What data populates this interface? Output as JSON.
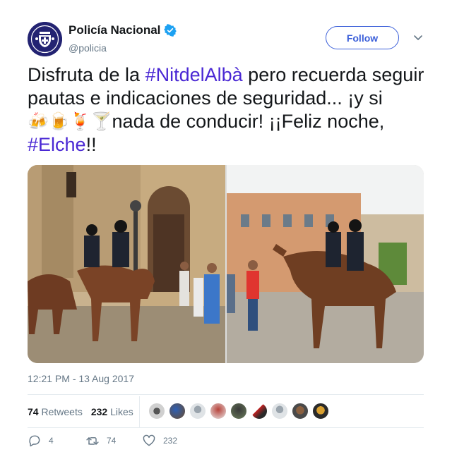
{
  "account": {
    "name": "Policía Nacional",
    "handle": "@policia",
    "verified": true,
    "avatar_icon": "policia-nacional-shield-emblem"
  },
  "header": {
    "follow_label": "Follow",
    "more_icon": "chevron-down-icon"
  },
  "tweet": {
    "segments": {
      "s1": "Disfruta de la ",
      "h1": "#NitdelAlbà",
      "s2": " pero recuerda seguir pautas e indicaciones de seguridad... ¡y si ",
      "emojis": "🍻🍺🍹🍸",
      "s3": "nada de conducir! ¡¡Feliz noche, ",
      "h2": "#Elche",
      "s4": "!!"
    },
    "hashtag_color": "#4a28d4",
    "photos": [
      {
        "description": "mounted police in front of church"
      },
      {
        "description": "mounted police in plaza"
      }
    ],
    "timestamp": "12:21 PM - 13 Aug 2017"
  },
  "stats": {
    "retweets_count": "74",
    "retweets_label": "Retweets",
    "likes_count": "232",
    "likes_label": "Likes"
  },
  "actions": {
    "replies": "4",
    "retweets": "74",
    "likes": "232"
  },
  "colors": {
    "accent": "#3b5fd9",
    "secondary_text": "#657786",
    "verified": "#1da1f2"
  }
}
